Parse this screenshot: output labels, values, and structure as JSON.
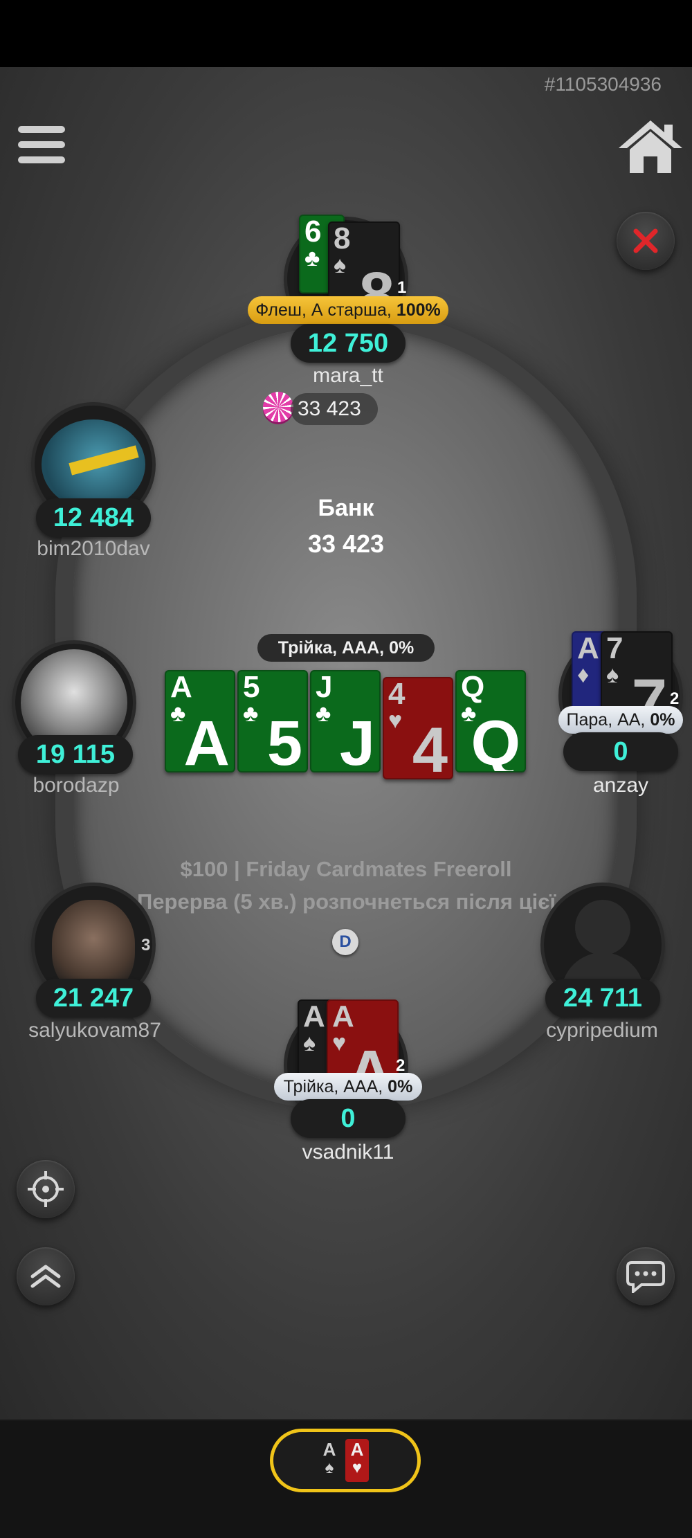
{
  "hand_id": "#1105304936",
  "pot": {
    "label": "Банк",
    "value": "33 423"
  },
  "community": {
    "hand_label": "Трійка, ААА, 0%",
    "cards": [
      {
        "rank": "A",
        "suit": "♣",
        "color": "green"
      },
      {
        "rank": "5",
        "suit": "♣",
        "color": "green"
      },
      {
        "rank": "J",
        "suit": "♣",
        "color": "green"
      },
      {
        "rank": "4",
        "suit": "♥",
        "color": "red"
      },
      {
        "rank": "Q",
        "suit": "♣",
        "color": "green"
      }
    ]
  },
  "tournament": {
    "title": "$100 | Friday Cardmates Freeroll",
    "status": "Перерва (5 хв.) розпочнеться після цієї руки"
  },
  "players": {
    "mara_tt": {
      "name": "mara_tt",
      "stack": "12 750",
      "timer": "1",
      "hand_label_main": "Флеш, А старша, ",
      "hand_label_pct": "100%",
      "bet": "33 423",
      "cards": [
        {
          "rank": "6",
          "suit": "♣"
        },
        {
          "rank": "8",
          "suit": "♠"
        }
      ]
    },
    "bim2010dav": {
      "name": "bim2010dav",
      "stack": "12 484"
    },
    "borodazp": {
      "name": "borodazp",
      "stack": "19 115"
    },
    "anzay": {
      "name": "anzay",
      "stack": "0",
      "timer": "2",
      "hand_label_main": "Пара, АА, ",
      "hand_label_pct": "0%",
      "cards": [
        {
          "rank": "A",
          "suit": "♦"
        },
        {
          "rank": "7",
          "suit": "♠"
        }
      ]
    },
    "salyukovam87": {
      "name": "salyukovam87",
      "stack": "21 247",
      "timer": "3"
    },
    "cypripedium": {
      "name": "cypripedium",
      "stack": "24 711"
    },
    "vsadnik11": {
      "name": "vsadnik11",
      "stack": "0",
      "timer": "2",
      "hand_label_main": "Трійка, ААА, ",
      "hand_label_pct": "0%",
      "cards": [
        {
          "rank": "A",
          "suit": "♠"
        },
        {
          "rank": "A",
          "suit": "♥"
        }
      ]
    }
  },
  "dealer_button": "D",
  "my_hand": [
    {
      "rank": "A",
      "suit": "♠"
    },
    {
      "rank": "A",
      "suit": "♥"
    }
  ],
  "colors": {
    "stack_text": "#3ff0d8",
    "accent_gold": "#f0c419",
    "close_red": "#e0262a"
  }
}
